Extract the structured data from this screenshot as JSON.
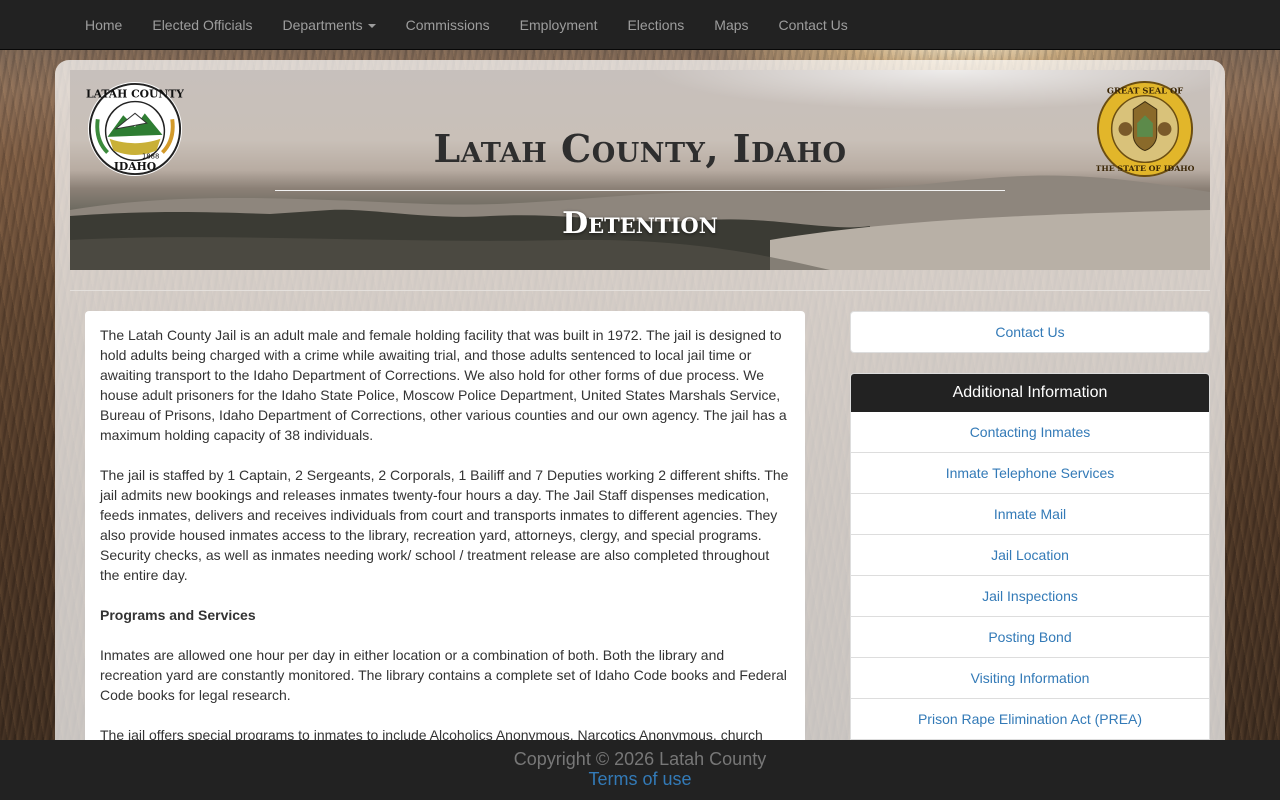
{
  "nav": {
    "items": [
      {
        "label": "Home"
      },
      {
        "label": "Elected Officials"
      },
      {
        "label": "Departments",
        "dropdown": true
      },
      {
        "label": "Commissions"
      },
      {
        "label": "Employment"
      },
      {
        "label": "Elections"
      },
      {
        "label": "Maps"
      },
      {
        "label": "Contact Us"
      }
    ]
  },
  "banner": {
    "title": "Latah County, Idaho",
    "subtitle": "Detention",
    "left_seal": {
      "icon": "latah-county-seal",
      "text_top": "LATAH COUNTY",
      "text_bottom": "IDAHO",
      "year": "1888"
    },
    "right_seal": {
      "icon": "idaho-state-seal",
      "text": "GREAT SEAL OF THE STATE OF IDAHO"
    }
  },
  "content": {
    "paragraphs": [
      "The Latah County Jail is an adult male and female holding facility that was built in 1972. The jail is designed to hold adults being charged with a crime while awaiting trial, and those adults sentenced to local jail time or awaiting transport to the Idaho Department of Corrections. We also hold for other forms of due process. We house adult prisoners for the Idaho State Police, Moscow Police Department, United States Marshals Service, Bureau of Prisons, Idaho Department of Corrections, other various counties and our own agency. The jail has a maximum holding capacity of 38 individuals.",
      "The jail is staffed by 1 Captain, 2 Sergeants, 2 Corporals, 1 Bailiff and 7 Deputies working 2 different shifts. The jail admits new bookings and releases inmates twenty-four hours a day. The Jail Staff dispenses medication, feeds inmates, delivers and receives individuals from court and transports inmates to different agencies. They also provide housed inmates access to the library, recreation yard, attorneys, clergy, and special programs. Security checks, as well as inmates needing work/ school / treatment release are also completed throughout the entire day.",
      "Programs and Services",
      "Inmates are allowed one hour per day in either location or a combination of both. Both the library and recreation yard are constantly monitored. The library contains a complete set of Idaho Code books and Federal Code books for legal research.",
      "The jail offers special programs to inmates to include Alcoholics Anonymous, Narcotics Anonymous, church"
    ]
  },
  "sidebar": {
    "contact_label": "Contact Us",
    "info_title": "Additional Information",
    "links": [
      {
        "label": "Contacting Inmates"
      },
      {
        "label": "Inmate Telephone Services"
      },
      {
        "label": "Inmate Mail"
      },
      {
        "label": "Jail Location"
      },
      {
        "label": "Jail Inspections"
      },
      {
        "label": "Posting Bond"
      },
      {
        "label": "Visiting Information"
      },
      {
        "label": "Prison Rape Elimination Act (PREA)"
      }
    ]
  },
  "footer": {
    "copyright": "Copyright © 2026 Latah County",
    "terms": "Terms of use"
  },
  "colors": {
    "navbar": "#222222",
    "nav_text": "#9d9d9d",
    "link": "#337ab7",
    "footer": "#222222"
  }
}
